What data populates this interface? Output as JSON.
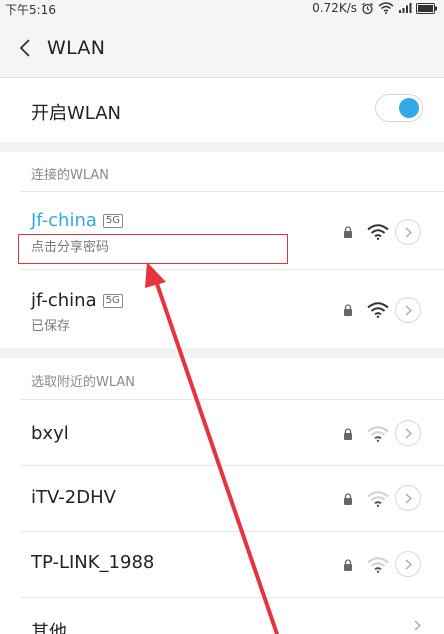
{
  "status": {
    "time": "下午5:16",
    "speed": "0.72K/s"
  },
  "header": {
    "title": "WLAN"
  },
  "toggle": {
    "label": "开启WLAN",
    "on": true
  },
  "connected_section": {
    "title": "连接的WLAN"
  },
  "networks_saved": [
    {
      "name": "Jf-china",
      "badge": "5G",
      "sub": "点击分享密码",
      "status": "connected",
      "locked": true,
      "signal": "strong"
    },
    {
      "name": "jf-china",
      "badge": "5G",
      "sub": "已保存",
      "status": "saved",
      "locked": true,
      "signal": "strong"
    }
  ],
  "nearby_section": {
    "title": "选取附近的WLAN"
  },
  "networks_nearby": [
    {
      "name": "bxyl",
      "locked": true,
      "signal": "weak"
    },
    {
      "name": "iTV-2DHV",
      "locked": true,
      "signal": "weak"
    },
    {
      "name": "TP-LINK_1988",
      "locked": true,
      "signal": "weak"
    }
  ],
  "other": {
    "label": "其他"
  },
  "colors": {
    "accent": "#33a7e8",
    "annotation": "#e3343f"
  }
}
